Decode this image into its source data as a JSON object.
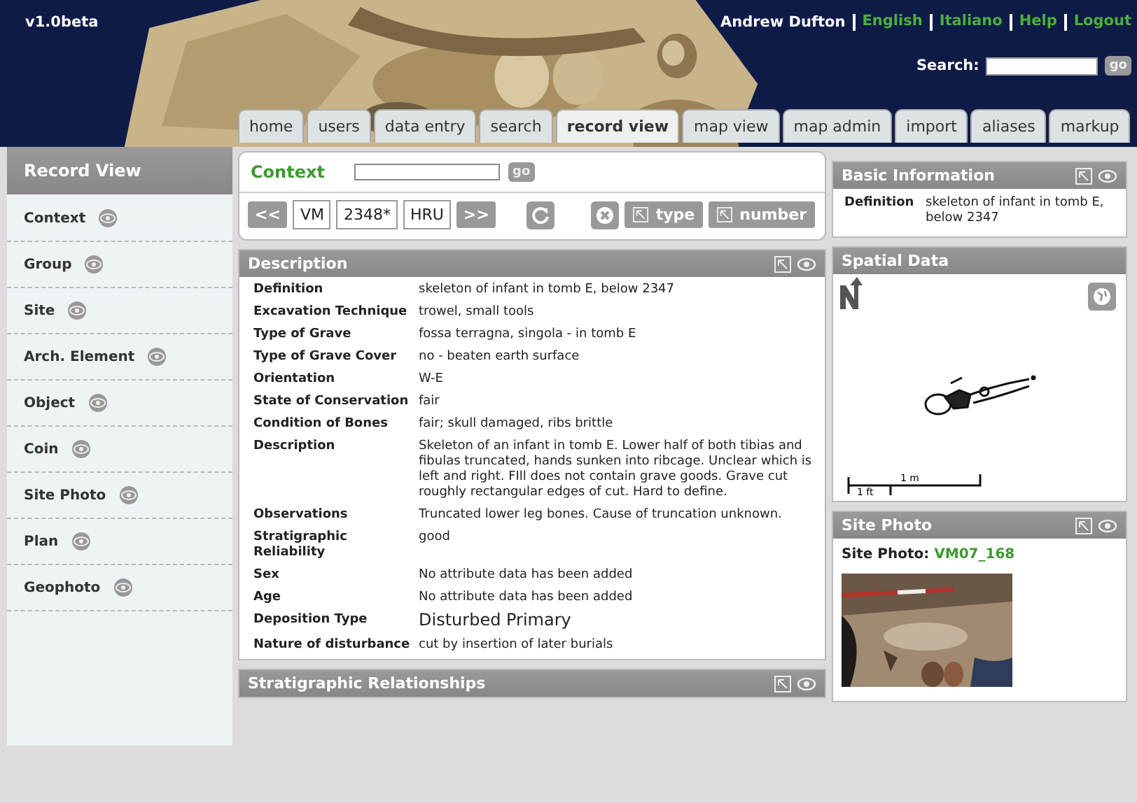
{
  "header": {
    "version": "v1.0beta",
    "user": "Andrew Dufton",
    "links": [
      {
        "label": "English"
      },
      {
        "label": "Italiano"
      },
      {
        "label": "Help"
      },
      {
        "label": "Logout"
      }
    ],
    "search": {
      "label": "Search:",
      "button": "go"
    }
  },
  "tabs": [
    {
      "label": "home",
      "selected": false
    },
    {
      "label": "users",
      "selected": false
    },
    {
      "label": "data entry",
      "selected": false
    },
    {
      "label": "search",
      "selected": false
    },
    {
      "label": "record view",
      "selected": true
    },
    {
      "label": "map view",
      "selected": false
    },
    {
      "label": "map admin",
      "selected": false
    },
    {
      "label": "import",
      "selected": false
    },
    {
      "label": "aliases",
      "selected": false
    },
    {
      "label": "markup",
      "selected": false
    }
  ],
  "sidebar": {
    "title": "Record View",
    "items": [
      {
        "label": "Context"
      },
      {
        "label": "Group"
      },
      {
        "label": "Site"
      },
      {
        "label": "Arch. Element"
      },
      {
        "label": "Object"
      },
      {
        "label": "Coin"
      },
      {
        "label": "Site Photo"
      },
      {
        "label": "Plan"
      },
      {
        "label": "Geophoto"
      }
    ]
  },
  "context": {
    "title": "Context",
    "button": "go",
    "prev": "<<",
    "next": ">>",
    "fields": [
      "VM",
      "2348*",
      "HRU"
    ],
    "filters": [
      "type",
      "number"
    ]
  },
  "description": {
    "title": "Description",
    "rows": [
      {
        "label": "Definition",
        "value": "skeleton of infant in tomb E, below 2347",
        "kind": "text"
      },
      {
        "label": "Excavation Technique",
        "value": "trowel, small tools",
        "kind": "text"
      },
      {
        "label": "Type of Grave",
        "value": "fossa terragna, singola - in tomb E",
        "kind": "text"
      },
      {
        "label": "Type of Grave Cover",
        "value": "no - beaten earth surface",
        "kind": "text"
      },
      {
        "label": "Orientation",
        "value": "W-E",
        "kind": "text"
      },
      {
        "label": "State of Conservation",
        "value": "fair",
        "kind": "text"
      },
      {
        "label": "Condition of Bones",
        "value": "fair; skull damaged, ribs brittle",
        "kind": "text"
      },
      {
        "label": "Description",
        "value": "Skeleton of an infant in tomb E. Lower half of both tibias and fibulas truncated, hands sunken into ribcage. Unclear which is left and right. FIll does not contain grave goods. Grave cut roughly rectangular edges of cut. Hard to define.",
        "kind": "text"
      },
      {
        "label": "Observations",
        "value": "Truncated lower leg bones. Cause of truncation unknown.",
        "kind": "text"
      },
      {
        "label": "Stratigraphic Reliability",
        "value": "good",
        "kind": "text"
      },
      {
        "label": "Sex",
        "value": "No attribute data has been added",
        "kind": "text"
      },
      {
        "label": "Age",
        "value": "No attribute data has been added",
        "kind": "text"
      },
      {
        "label": "Deposition Type",
        "value": "Disturbed Primary",
        "kind": "edit"
      },
      {
        "label": "Nature of disturbance",
        "value": "cut by insertion of later burials",
        "kind": "text"
      }
    ]
  },
  "strat": {
    "title": "Stratigraphic Relationships"
  },
  "basic": {
    "title": "Basic Information",
    "label": "Definition",
    "value": "skeleton of infant in tomb E, below 2347"
  },
  "spatial": {
    "title": "Spatial Data",
    "scale_m": "1 m",
    "scale_ft": "1 ft"
  },
  "photo": {
    "title": "Site Photo",
    "label": "Site Photo:",
    "link": "VM07_168"
  }
}
